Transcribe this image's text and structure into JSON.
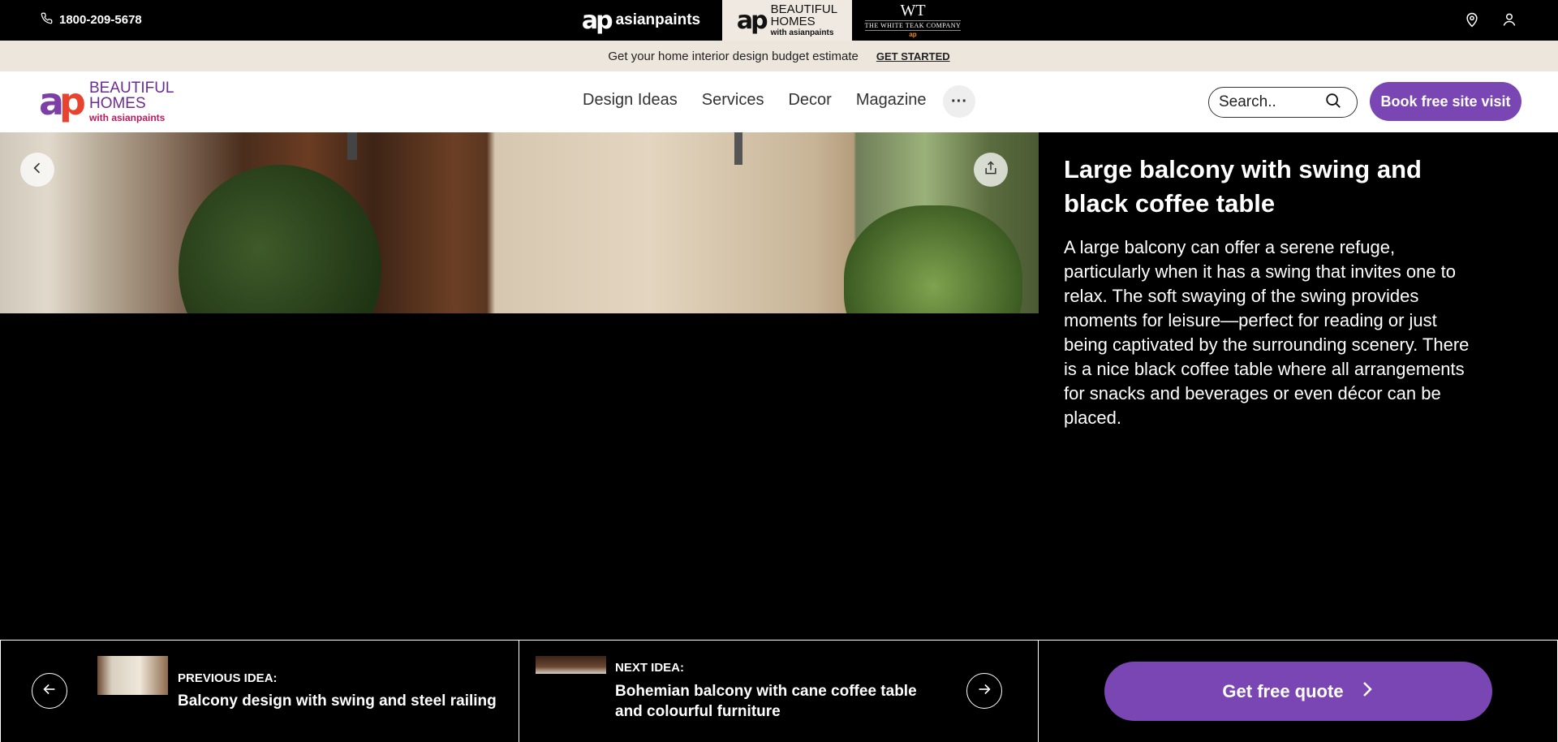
{
  "topbar": {
    "phone": "1800-209-5678",
    "brands": {
      "asianpaints": "asianpaints",
      "beautiful_homes_line1": "BEAUTIFUL",
      "beautiful_homes_line2": "HOMES",
      "beautiful_homes_line3": "with asianpaints",
      "white_teak_mark": "WT",
      "white_teak_name": "THE WHITE TEAK COMPANY",
      "white_teak_sub": "ap"
    }
  },
  "promo": {
    "text": "Get your home interior design budget estimate",
    "cta": "GET STARTED"
  },
  "nav": {
    "logo_line1": "BEAUTIFUL",
    "logo_line2": "HOMES",
    "logo_line3": "with asianpaints",
    "menu": [
      "Design Ideas",
      "Services",
      "Decor",
      "Magazine"
    ],
    "more": "···",
    "search_placeholder": "Search..",
    "book_button": "Book free site visit"
  },
  "design": {
    "title": "Large balcony with swing and black coffee table",
    "description": "A large balcony can offer a serene refuge, particularly when it has a swing that invites one to relax. The soft swaying of the swing provides moments for leisure—perfect for reading or just being captivated by the surrounding scenery. There is a nice black coffee table where all arrangements for snacks and beverages or even décor can be placed."
  },
  "bottom": {
    "prev_label": "PREVIOUS IDEA:",
    "prev_title": "Balcony design with swing and steel railing",
    "next_label": "NEXT IDEA:",
    "next_title": "Bohemian balcony with cane coffee table and colourful furniture",
    "quote_button": "Get free quote"
  },
  "colors": {
    "accent": "#7a46b3",
    "promo_bg": "#ede6dd"
  }
}
